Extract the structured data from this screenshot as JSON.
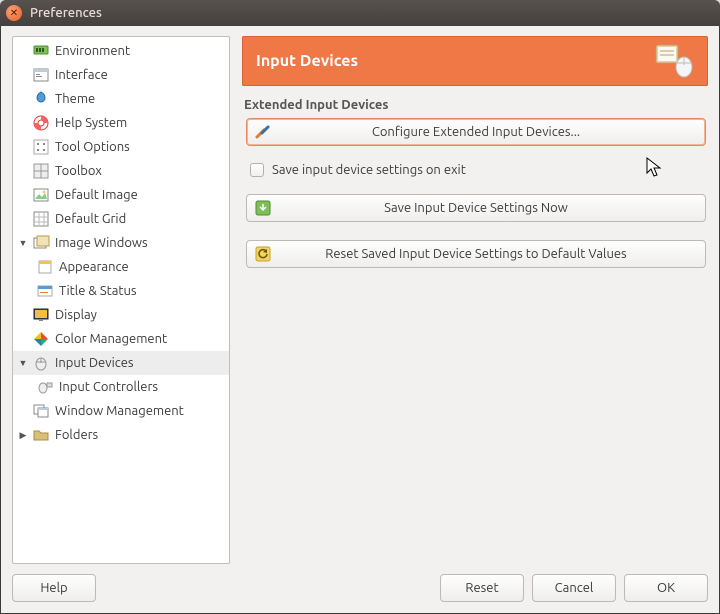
{
  "window": {
    "title": "Preferences"
  },
  "sidebar": {
    "items": [
      {
        "label": "Environment",
        "icon": "env"
      },
      {
        "label": "Interface",
        "icon": "interface"
      },
      {
        "label": "Theme",
        "icon": "theme"
      },
      {
        "label": "Help System",
        "icon": "help"
      },
      {
        "label": "Tool Options",
        "icon": "tool-opt"
      },
      {
        "label": "Toolbox",
        "icon": "toolbox"
      },
      {
        "label": "Default Image",
        "icon": "default-image"
      },
      {
        "label": "Default Grid",
        "icon": "default-grid"
      },
      {
        "label": "Image Windows",
        "icon": "image-windows",
        "expander": "▼",
        "children": [
          {
            "label": "Appearance",
            "icon": "appearance"
          },
          {
            "label": "Title & Status",
            "icon": "title-status"
          }
        ]
      },
      {
        "label": "Display",
        "icon": "display"
      },
      {
        "label": "Color Management",
        "icon": "color"
      },
      {
        "label": "Input Devices",
        "icon": "input-devices",
        "expander": "▼",
        "selected": true,
        "children": [
          {
            "label": "Input Controllers",
            "icon": "input-controllers"
          }
        ]
      },
      {
        "label": "Window Management",
        "icon": "window-mgmt"
      },
      {
        "label": "Folders",
        "icon": "folders",
        "expander": "▶"
      }
    ]
  },
  "main": {
    "header_title": "Input Devices",
    "section": "Extended Input Devices",
    "configure_btn": "Configure Extended Input Devices...",
    "save_on_exit": "Save input device settings on exit",
    "save_now_btn": "Save Input Device Settings Now",
    "reset_defaults_btn": "Reset Saved Input Device Settings to Default Values"
  },
  "footer": {
    "help": "Help",
    "reset": "Reset",
    "cancel": "Cancel",
    "ok": "OK"
  }
}
